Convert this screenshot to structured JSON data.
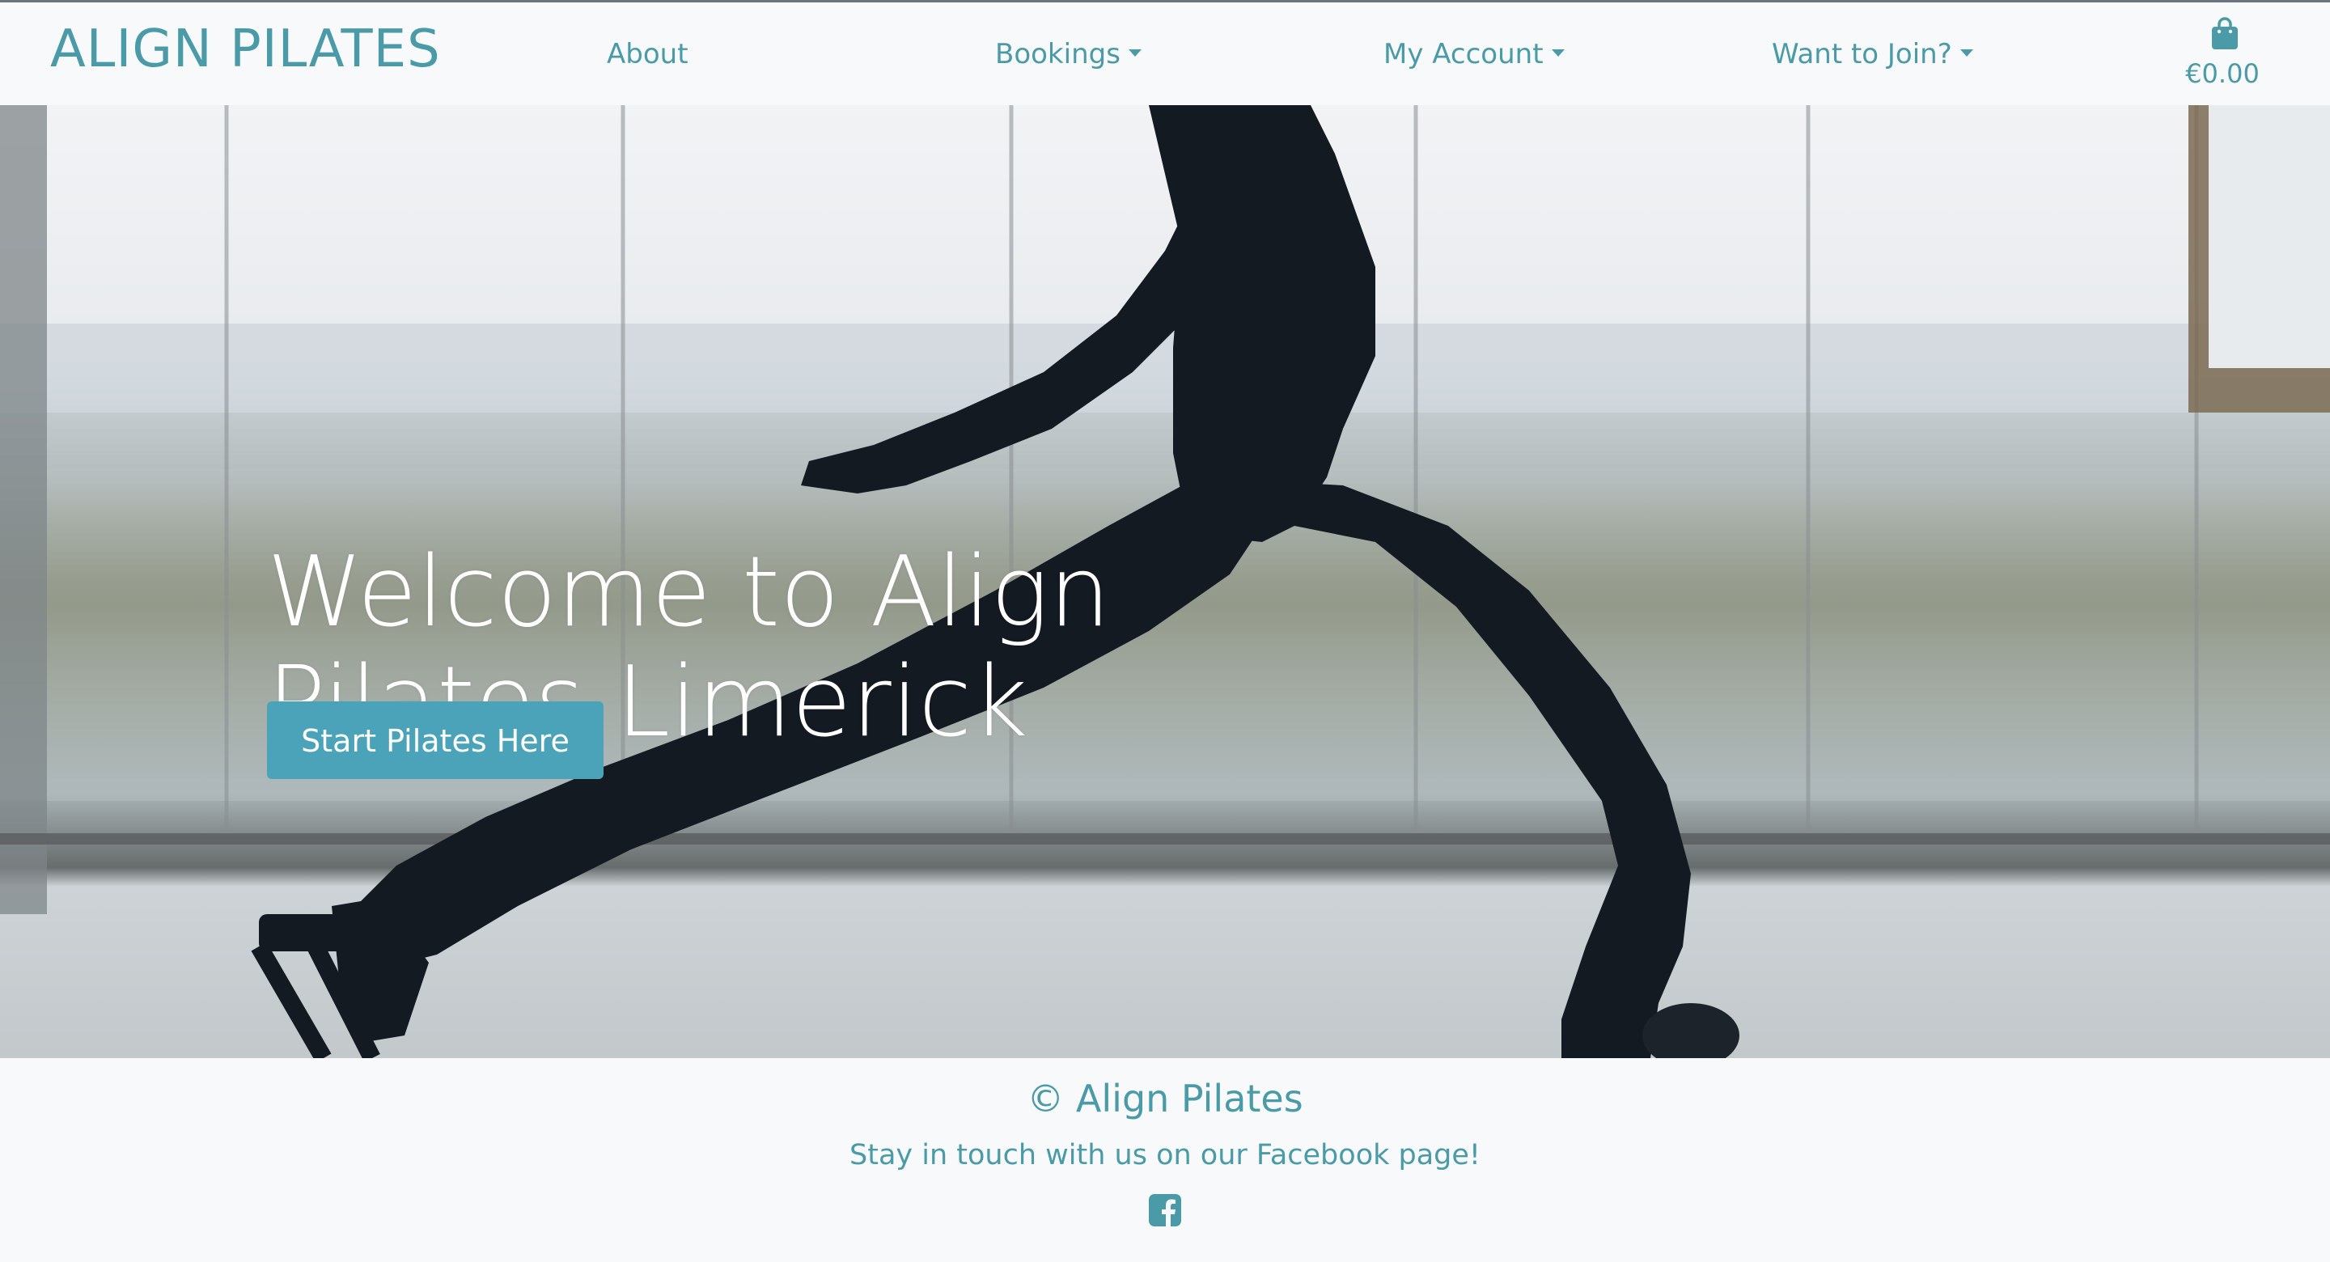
{
  "navbar": {
    "brand": "ALIGN PILATES",
    "items": [
      {
        "label": "About",
        "dropdown": false
      },
      {
        "label": "Bookings",
        "dropdown": true
      },
      {
        "label": "My Account",
        "dropdown": true
      },
      {
        "label": "Want to Join?",
        "dropdown": true
      }
    ],
    "cart": {
      "icon": "shopping-bag-icon",
      "total": "€0.00"
    }
  },
  "hero": {
    "title": "Welcome to Align Pilates Limerick",
    "button_label": "Start Pilates Here"
  },
  "footer": {
    "title": "© Align Pilates",
    "text": "Stay in touch with us on our Facebook page!",
    "social_icon": "facebook-square-icon"
  },
  "colors": {
    "accent": "#4a9aa8",
    "button": "#4aa3b8",
    "background": "#f8f9fa"
  }
}
